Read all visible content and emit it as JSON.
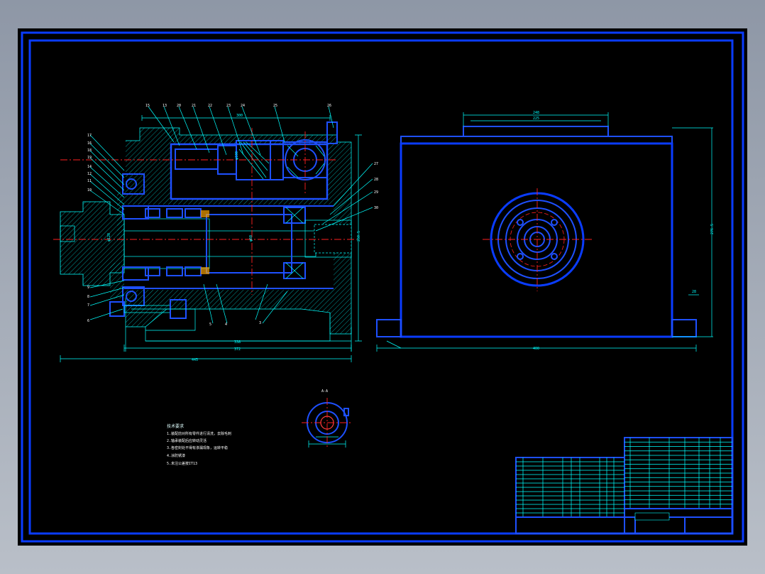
{
  "colors": {
    "background": "#000000",
    "frame": "#0a3cff",
    "dimension": "#00ffff",
    "centerline": "#ff2020",
    "window_chrome": "#8e97a6"
  },
  "section_label": "A-A",
  "notes": {
    "heading": "技术要求",
    "lines": [
      "1.装配前对所有零件进行清洗，去除毛刺",
      "2.轴承装配后应转动灵活",
      "3.各密封处不得有渗漏现象，运转平稳",
      "4.涂防锈漆",
      "5.未注公差按IT13"
    ]
  },
  "balloons": [
    "15",
    "13",
    "20",
    "21",
    "22",
    "23",
    "24",
    "25",
    "26",
    "17",
    "16",
    "18",
    "19",
    "14",
    "12",
    "11",
    "10",
    "9",
    "8",
    "7",
    "6",
    "5",
    "4",
    "3",
    "27",
    "28",
    "29",
    "30",
    "2",
    "1"
  ]
}
